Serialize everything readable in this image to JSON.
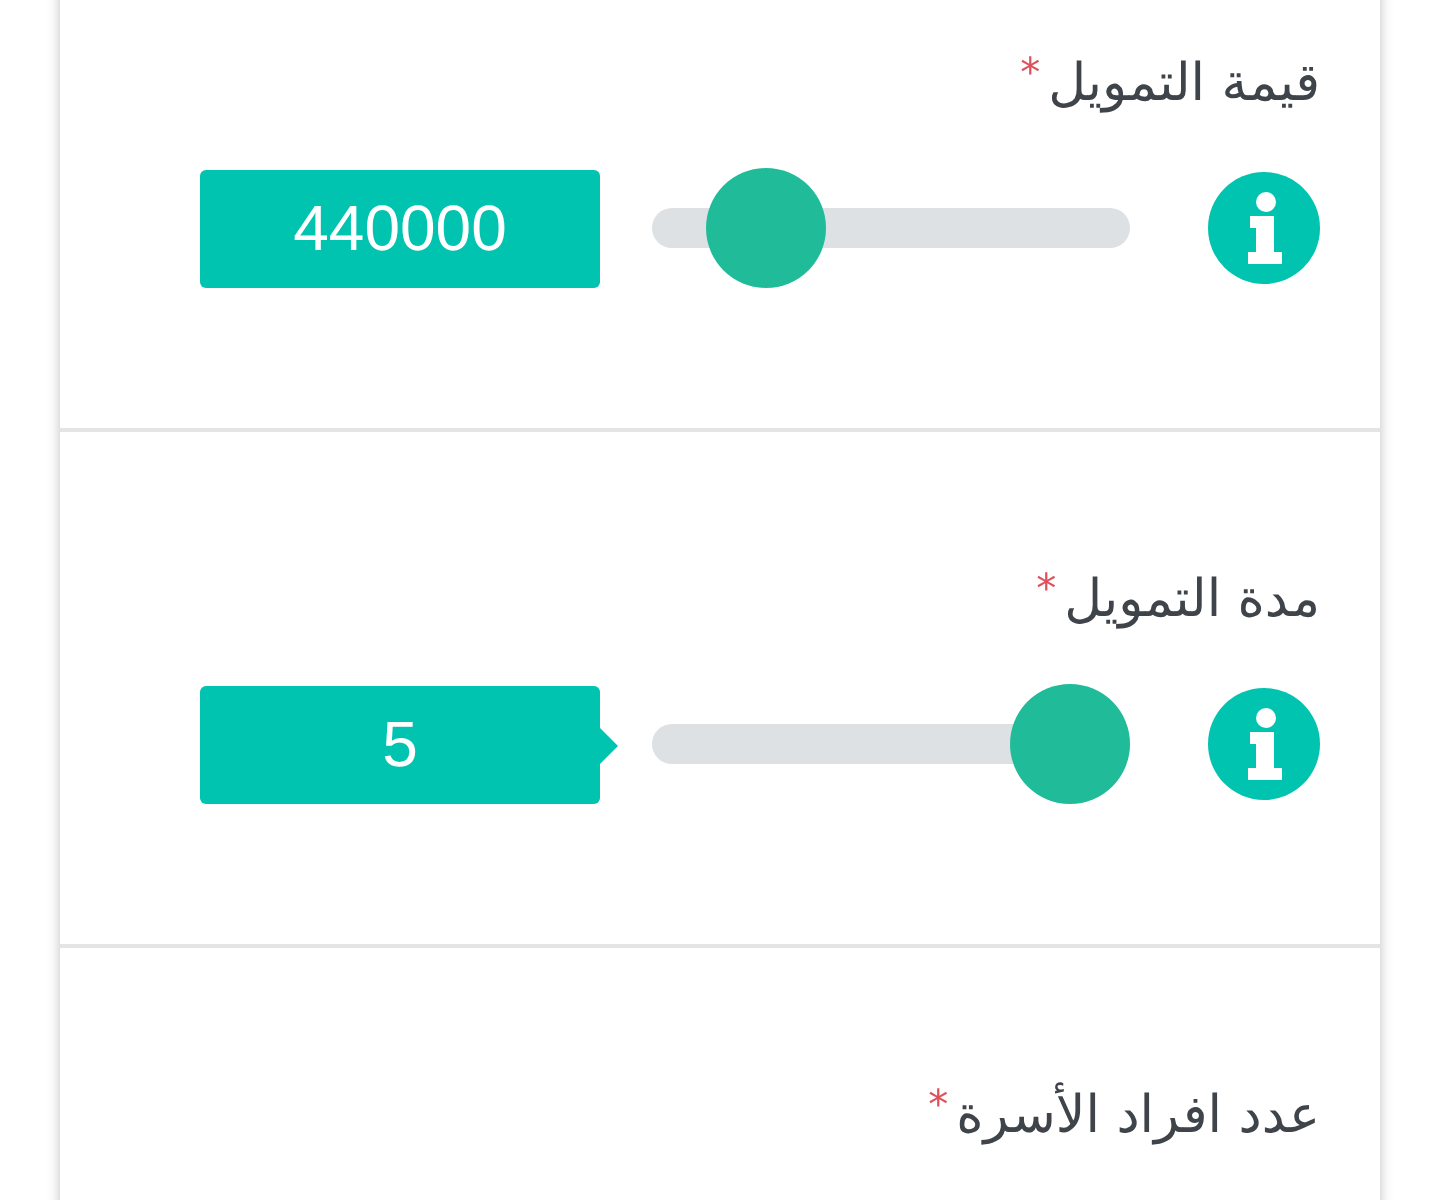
{
  "fields": [
    {
      "label": "قيمة التمويل",
      "required_mark": "*",
      "value": "440000",
      "level": 0.15,
      "pointer": false
    },
    {
      "label": "مدة التمويل",
      "required_mark": "*",
      "value": "5",
      "level": 1,
      "pointer": true
    },
    {
      "label": "عدد افراد الأسرة",
      "required_mark": "*"
    }
  ]
}
